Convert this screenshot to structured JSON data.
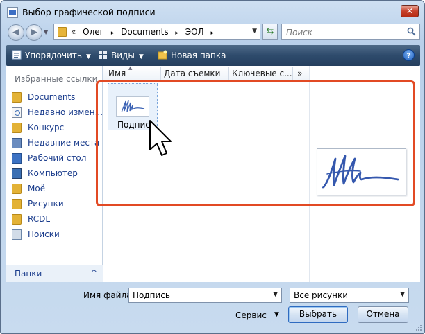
{
  "window": {
    "title": "Выбор графической подписи",
    "close_label": "✕"
  },
  "address_bar": {
    "prefix": "«",
    "path": [
      "Олег",
      "Documents",
      "ЭОЛ"
    ],
    "separator": "▸"
  },
  "search": {
    "placeholder": "Поиск"
  },
  "toolbar": {
    "organize_label": "Упорядочить",
    "views_label": "Виды",
    "new_folder_label": "Новая папка",
    "help_label": "?"
  },
  "favorites": {
    "title": "Избранные ссылки",
    "items": [
      {
        "label": "Documents",
        "icon": "folder-icon"
      },
      {
        "label": "Недавно измен...",
        "icon": "recent-changes-icon"
      },
      {
        "label": "Конкурс",
        "icon": "folder-icon"
      },
      {
        "label": "Недавние места",
        "icon": "recent-places-icon"
      },
      {
        "label": "Рабочий стол",
        "icon": "desktop-icon"
      },
      {
        "label": "Компьютер",
        "icon": "computer-icon"
      },
      {
        "label": "Моё",
        "icon": "folder-icon"
      },
      {
        "label": "Рисунки",
        "icon": "folder-icon"
      },
      {
        "label": "RCDL",
        "icon": "folder-icon"
      },
      {
        "label": "Поиски",
        "icon": "searches-icon"
      }
    ]
  },
  "folders_pane": {
    "label": "Папки",
    "arrow": "^"
  },
  "file_list": {
    "columns": [
      "Имя",
      "Дата съемки",
      "Ключевые с...",
      "»"
    ],
    "files": [
      {
        "name": "Подпись"
      }
    ]
  },
  "footer": {
    "filename_label": "Имя файла:",
    "filename_value": "Подпись",
    "filter_value": "Все рисунки",
    "service_label": "Сервис",
    "select_label": "Выбрать",
    "cancel_label": "Отмена"
  },
  "colors": {
    "highlight": "#e24a24",
    "link": "#1a3c8c",
    "toolbar": "#2e4b6c"
  }
}
